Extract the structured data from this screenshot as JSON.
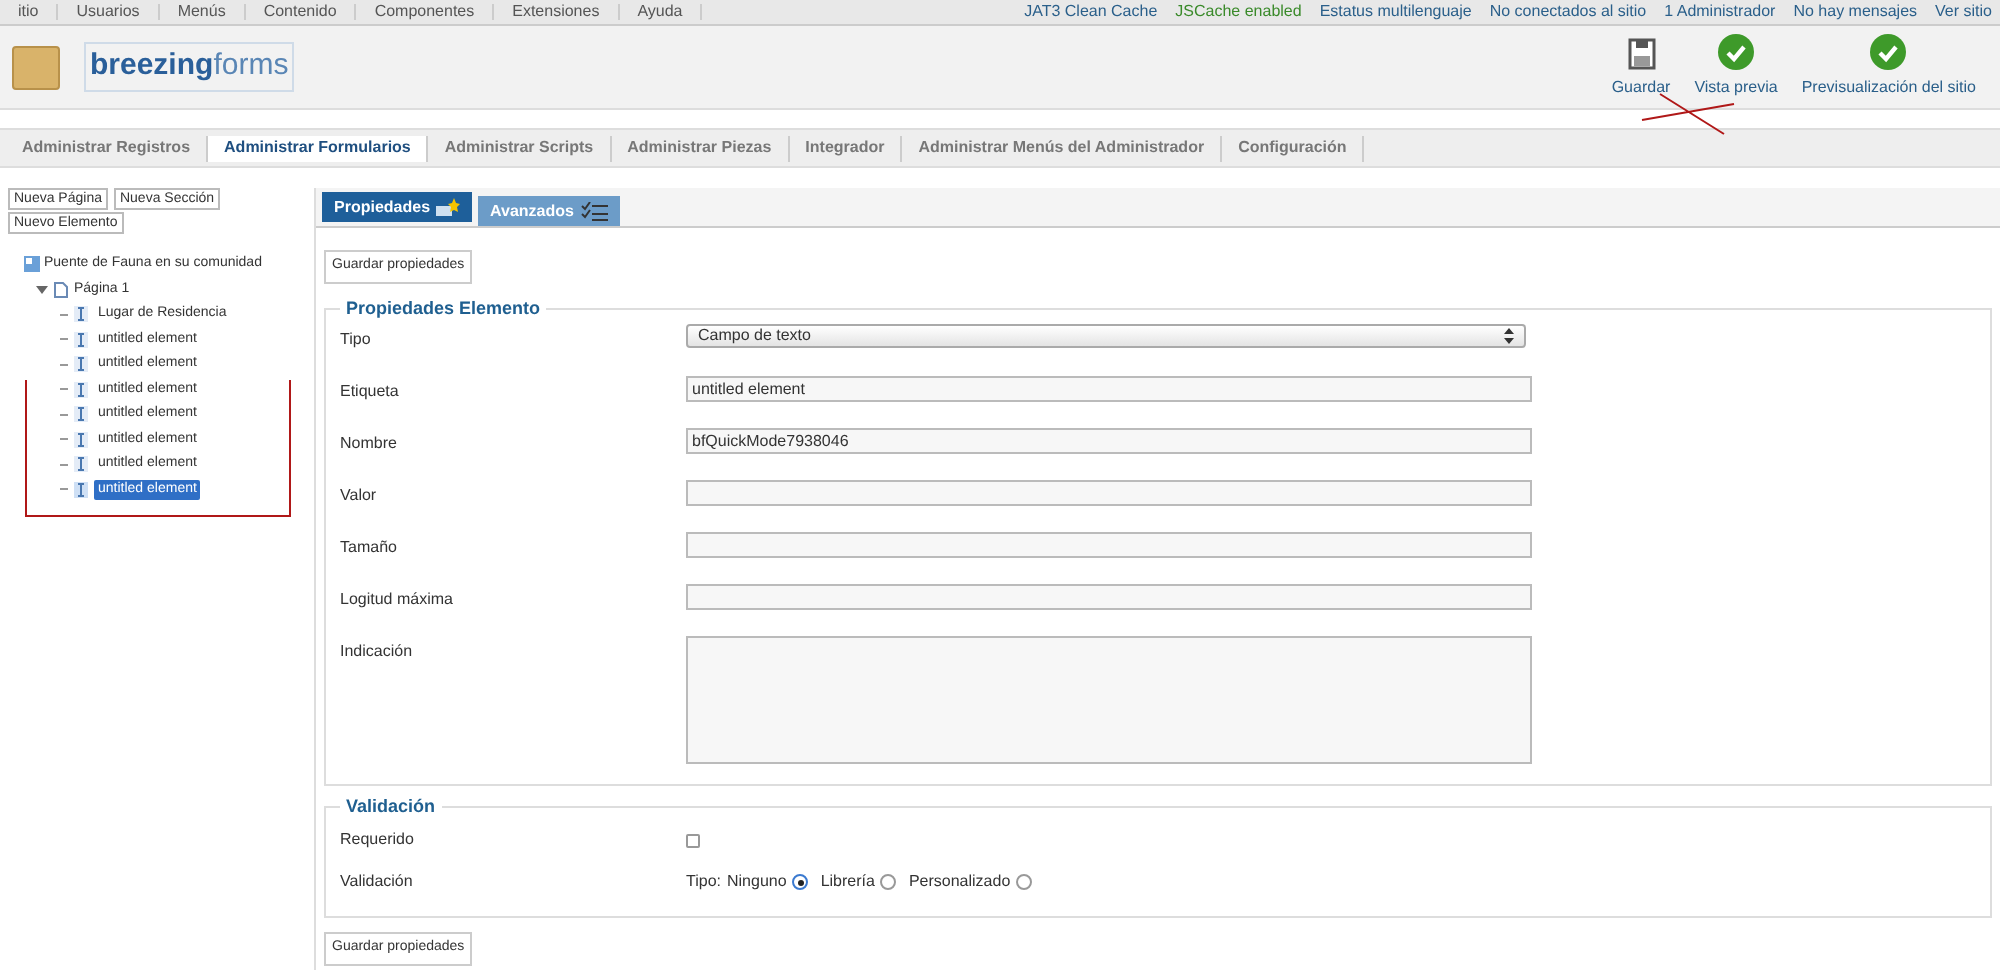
{
  "top_menu": [
    {
      "label": "itio"
    },
    {
      "label": "Usuarios"
    },
    {
      "label": "Menús"
    },
    {
      "label": "Contenido"
    },
    {
      "label": "Componentes"
    },
    {
      "label": "Extensiones"
    },
    {
      "label": "Ayuda"
    }
  ],
  "status_items": [
    {
      "label": "JAT3 Clean Cache"
    },
    {
      "label": "JSCache enabled"
    },
    {
      "label": "Estatus multilenguaje"
    },
    {
      "label": "No conectados al sitio"
    },
    {
      "label": "1 Administrador"
    },
    {
      "label": "No hay mensajes"
    },
    {
      "label": "Ver sitio"
    }
  ],
  "logo": {
    "bold": "breezing",
    "light": "forms"
  },
  "toolbar": [
    {
      "label": "Guardar",
      "kind": "save"
    },
    {
      "label": "Vista previa",
      "kind": "check"
    },
    {
      "label": "Previsualización del sitio",
      "kind": "check"
    }
  ],
  "submenu": [
    {
      "label": "Administrar Registros",
      "selected": false
    },
    {
      "label": "Administrar Formularios",
      "selected": true
    },
    {
      "label": "Administrar Scripts",
      "selected": false
    },
    {
      "label": "Administrar Piezas",
      "selected": false
    },
    {
      "label": "Integrador",
      "selected": false
    },
    {
      "label": "Administrar Menús del Administrador",
      "selected": false
    },
    {
      "label": "Configuración",
      "selected": false
    }
  ],
  "tree_buttons": [
    "Nueva Página",
    "Nueva Sección",
    "Nuevo Elemento"
  ],
  "tree": {
    "label": "Puente de Fauna en su comunidad",
    "children": [
      {
        "label": "Página 1",
        "expanded": true,
        "children": [
          {
            "label": "Lugar de Residencia",
            "selected": false
          },
          {
            "label": "untitled element",
            "selected": false
          },
          {
            "label": "untitled element",
            "selected": false
          },
          {
            "label": "untitled element",
            "selected": false
          },
          {
            "label": "untitled element",
            "selected": false
          },
          {
            "label": "untitled element",
            "selected": false
          },
          {
            "label": "untitled element",
            "selected": false
          },
          {
            "label": "untitled element",
            "selected": true
          }
        ]
      }
    ]
  },
  "tabs": [
    {
      "label": "Propiedades",
      "selected": true
    },
    {
      "label": "Avanzados",
      "selected": false
    }
  ],
  "save_button": "Guardar propiedades",
  "properties": {
    "legend": "Propiedades Elemento",
    "fields": [
      {
        "label": "Tipo",
        "kind": "select",
        "value": "Campo de texto"
      },
      {
        "label": "Etiqueta",
        "kind": "text",
        "value": "untitled element"
      },
      {
        "label": "Nombre",
        "kind": "text",
        "value": "bfQuickMode7938046"
      },
      {
        "label": "Valor",
        "kind": "text"
      },
      {
        "label": "Tamaño",
        "kind": "text"
      },
      {
        "label": "Logitud máxima",
        "kind": "text"
      },
      {
        "label": "Indicación",
        "kind": "textarea"
      }
    ]
  },
  "validation": {
    "legend": "Validación",
    "required_label": "Requerido",
    "required_checked": false,
    "type_label": "Validación",
    "type_prefix": "Tipo:",
    "options": [
      {
        "label": "Ninguno",
        "selected": true
      },
      {
        "label": "Librería",
        "selected": false
      },
      {
        "label": "Personalizado",
        "selected": false
      }
    ]
  },
  "save_button_bottom": "Guardar propiedades"
}
